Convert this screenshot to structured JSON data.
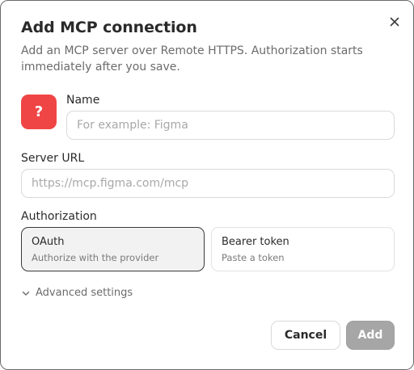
{
  "dialog": {
    "title": "Add MCP connection",
    "subtitle": "Add an MCP server over Remote HTTPS. Authorization starts immediately after you save.",
    "close_icon": "close-icon"
  },
  "server_icon": {
    "glyph": "?",
    "icon": "question-mark-icon",
    "color": "#f04545"
  },
  "name_field": {
    "label": "Name",
    "value": "",
    "placeholder": "For example: Figma"
  },
  "url_field": {
    "label": "Server URL",
    "value": "",
    "placeholder": "https://mcp.figma.com/mcp"
  },
  "authorization": {
    "label": "Authorization",
    "options": [
      {
        "title": "OAuth",
        "description": "Authorize with the provider",
        "selected": true
      },
      {
        "title": "Bearer token",
        "description": "Paste a token",
        "selected": false
      }
    ]
  },
  "advanced": {
    "label": "Advanced settings",
    "icon": "chevron-down-icon"
  },
  "actions": {
    "cancel_label": "Cancel",
    "add_label": "Add",
    "add_disabled": true
  }
}
